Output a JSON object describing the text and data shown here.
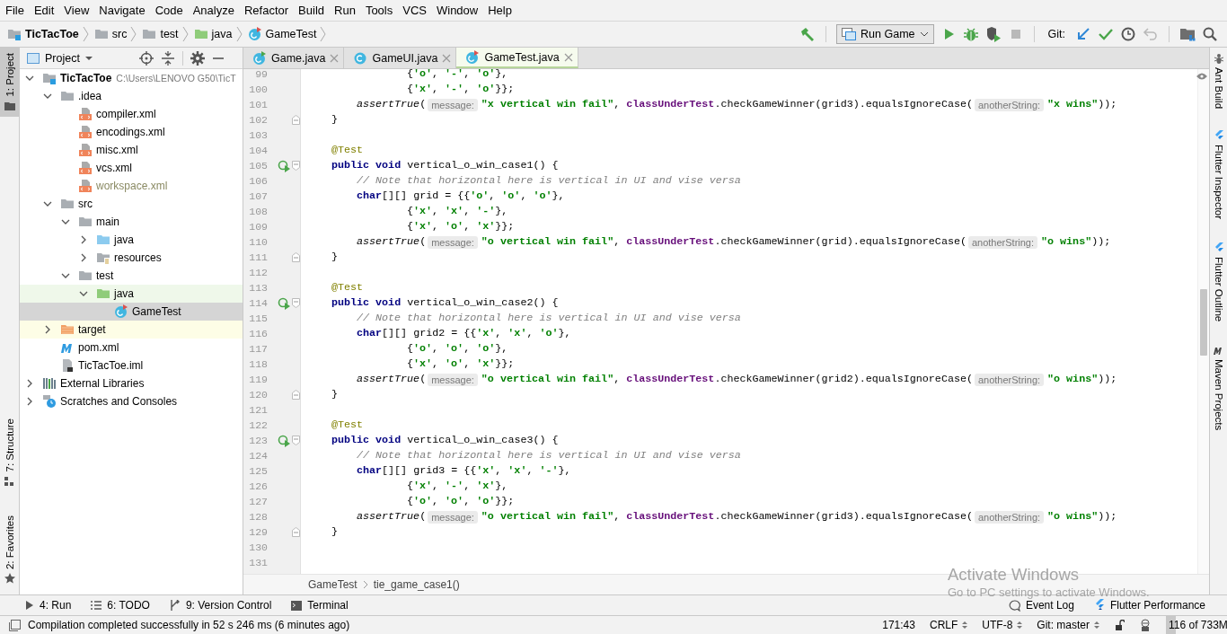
{
  "menu": [
    "File",
    "Edit",
    "View",
    "Navigate",
    "Code",
    "Analyze",
    "Refactor",
    "Build",
    "Run",
    "Tools",
    "VCS",
    "Window",
    "Help"
  ],
  "breadcrumb": [
    {
      "label": "TicTacToe",
      "kind": "module"
    },
    {
      "label": "src",
      "kind": "folder"
    },
    {
      "label": "test",
      "kind": "folder"
    },
    {
      "label": "java",
      "kind": "test-folder"
    },
    {
      "label": "GameTest",
      "kind": "test-class"
    }
  ],
  "toolbar": {
    "build_buttons": [
      {
        "kind": "build",
        "disabled": false
      }
    ],
    "run_config": "Run Game",
    "run_buttons": [
      {
        "kind": "run",
        "disabled": false
      },
      {
        "kind": "debug",
        "disabled": false
      },
      {
        "kind": "coverage",
        "disabled": false
      },
      {
        "kind": "stop",
        "disabled": true
      }
    ],
    "git_label": "Git:",
    "git_buttons": [
      {
        "kind": "update",
        "disabled": false
      },
      {
        "kind": "commit",
        "disabled": false
      },
      {
        "kind": "history",
        "disabled": false
      },
      {
        "kind": "revert",
        "disabled": true
      }
    ],
    "end_buttons": [
      {
        "kind": "structure",
        "disabled": false
      },
      {
        "kind": "search",
        "disabled": false
      }
    ]
  },
  "left_stripe": [
    {
      "label": "1: Project",
      "selected": true,
      "kind": "project"
    },
    {
      "label": "7: Structure",
      "selected": false,
      "kind": "structure"
    },
    {
      "label": "2: Favorites",
      "selected": false,
      "kind": "favorites"
    }
  ],
  "project": {
    "title": "Project",
    "tree": [
      {
        "label": "TicTacToe",
        "kind": "module",
        "path": "C:\\Users\\LENOVO G50\\TicT",
        "expanded": true,
        "selected": false,
        "children": [
          {
            "label": ".idea",
            "kind": "folder",
            "expanded": true,
            "selected": false,
            "children": [
              {
                "label": "compiler.xml",
                "kind": "xml",
                "selected": false,
                "ignored": false
              },
              {
                "label": "encodings.xml",
                "kind": "xml",
                "selected": false,
                "ignored": false
              },
              {
                "label": "misc.xml",
                "kind": "xml",
                "selected": false,
                "ignored": false
              },
              {
                "label": "vcs.xml",
                "kind": "xml",
                "selected": false,
                "ignored": false
              },
              {
                "label": "workspace.xml",
                "kind": "xml",
                "selected": false,
                "ignored": true
              }
            ]
          },
          {
            "label": "src",
            "kind": "folder",
            "expanded": true,
            "selected": false,
            "children": [
              {
                "label": "main",
                "kind": "folder",
                "expanded": true,
                "selected": false,
                "children": [
                  {
                    "label": "java",
                    "kind": "source-folder",
                    "expanded": false,
                    "selected": false
                  },
                  {
                    "label": "resources",
                    "kind": "resources-folder",
                    "expanded": false,
                    "selected": false
                  }
                ]
              },
              {
                "label": "test",
                "kind": "folder",
                "expanded": true,
                "selected": false,
                "children": [
                  {
                    "label": "java",
                    "kind": "test-folder",
                    "expanded": true,
                    "selected": false,
                    "children": [
                      {
                        "label": "GameTest",
                        "kind": "test-class",
                        "selected": true,
                        "ignored": false
                      }
                    ]
                  }
                ]
              }
            ]
          },
          {
            "label": "target",
            "kind": "excluded-folder",
            "expanded": false,
            "selected": false
          },
          {
            "label": "pom.xml",
            "kind": "maven",
            "selected": false,
            "ignored": false
          },
          {
            "label": "TicTacToe.iml",
            "kind": "iml",
            "selected": false,
            "ignored": false
          }
        ]
      },
      {
        "label": "External Libraries",
        "kind": "libraries",
        "expanded": false,
        "selected": false
      },
      {
        "label": "Scratches and Consoles",
        "kind": "scratches",
        "expanded": false,
        "selected": false
      }
    ]
  },
  "tabs": [
    {
      "label": "Game.java",
      "kind": "runnable-class",
      "selected": false
    },
    {
      "label": "GameUI.java",
      "kind": "class",
      "selected": false
    },
    {
      "label": "GameTest.java",
      "kind": "test-class",
      "selected": true
    }
  ],
  "editor": {
    "lines": [
      {
        "n": "99",
        "kind": "continuation",
        "segments": [
          {
            "kind": "code",
            "text": "{**'o'**, **'-'**, **'o'**},",
            "marks": [
              {
                "kind": "string"
              },
              {
                "kind": "string"
              },
              {
                "kind": "string"
              }
            ]
          }
        ]
      },
      {
        "n": "100",
        "kind": "continuation",
        "segments": [
          {
            "kind": "code",
            "text": "{**'x'**, **'-'**, **'o'**}};",
            "marks": [
              {
                "kind": "string"
              },
              {
                "kind": "string"
              },
              {
                "kind": "string"
              }
            ]
          }
        ]
      },
      {
        "n": "101",
        "kind": "body",
        "segments": [
          {
            "kind": "code",
            "text": "*assertTrue*(",
            "marks": [
              {
                "kind": "call"
              }
            ]
          },
          {
            "kind": "hint",
            "text": "message:"
          },
          {
            "kind": "code",
            "text": "**\"x vertical win fail\"**, **classUnderTest**.checkGameWinner(grid3).equalsIgnoreCase(",
            "marks": [
              {
                "kind": "string"
              },
              {
                "kind": "field"
              }
            ]
          },
          {
            "kind": "hint",
            "text": "anotherString:"
          },
          {
            "kind": "code",
            "text": "**\"x wins\"**));",
            "marks": [
              {
                "kind": "string"
              }
            ]
          }
        ]
      },
      {
        "n": "102",
        "kind": "member",
        "gutter": {
          "kind": "fold"
        },
        "segments": [
          {
            "kind": "code",
            "text": "}"
          }
        ]
      },
      {
        "n": "103"
      },
      {
        "n": "104",
        "kind": "member",
        "segments": [
          {
            "kind": "annotation",
            "text": "@Test"
          }
        ]
      },
      {
        "n": "105",
        "kind": "member",
        "gutter": {
          "kind": "run-fold"
        },
        "segments": [
          {
            "kind": "code",
            "text": "**public void** vertical_o_win_case1() {",
            "marks": [
              {
                "kind": "keyword"
              }
            ]
          }
        ]
      },
      {
        "n": "106",
        "kind": "body",
        "segments": [
          {
            "kind": "comment",
            "text": "// Note that horizontal here is vertical in UI and vise versa"
          }
        ]
      },
      {
        "n": "107",
        "kind": "body",
        "segments": [
          {
            "kind": "code",
            "text": "**char**[][] grid = {{**'o'**, **'o'**, **'o'**},",
            "marks": [
              {
                "kind": "keyword"
              },
              {
                "kind": "string"
              },
              {
                "kind": "string"
              },
              {
                "kind": "string"
              }
            ]
          }
        ]
      },
      {
        "n": "108",
        "kind": "continuation",
        "segments": [
          {
            "kind": "code",
            "text": "{**'x'**, **'x'**, **'-'**},",
            "marks": [
              {
                "kind": "string"
              },
              {
                "kind": "string"
              },
              {
                "kind": "string"
              }
            ]
          }
        ]
      },
      {
        "n": "109",
        "kind": "continuation",
        "segments": [
          {
            "kind": "code",
            "text": "{**'x'**, **'o'**, **'x'**}};",
            "marks": [
              {
                "kind": "string"
              },
              {
                "kind": "string"
              },
              {
                "kind": "string"
              }
            ]
          }
        ]
      },
      {
        "n": "110",
        "kind": "body",
        "segments": [
          {
            "kind": "code",
            "text": "*assertTrue*(",
            "marks": [
              {
                "kind": "call"
              }
            ]
          },
          {
            "kind": "hint",
            "text": "message:"
          },
          {
            "kind": "code",
            "text": "**\"o vertical win fail\"**, **classUnderTest**.checkGameWinner(grid).equalsIgnoreCase(",
            "marks": [
              {
                "kind": "string"
              },
              {
                "kind": "field"
              }
            ]
          },
          {
            "kind": "hint",
            "text": "anotherString:"
          },
          {
            "kind": "code",
            "text": "**\"o wins\"**));",
            "marks": [
              {
                "kind": "string"
              }
            ]
          }
        ]
      },
      {
        "n": "111",
        "kind": "member",
        "gutter": {
          "kind": "fold"
        },
        "segments": [
          {
            "kind": "code",
            "text": "}"
          }
        ]
      },
      {
        "n": "112"
      },
      {
        "n": "113",
        "kind": "member",
        "segments": [
          {
            "kind": "annotation",
            "text": "@Test"
          }
        ]
      },
      {
        "n": "114",
        "kind": "member",
        "gutter": {
          "kind": "run-fold"
        },
        "segments": [
          {
            "kind": "code",
            "text": "**public void** vertical_o_win_case2() {",
            "marks": [
              {
                "kind": "keyword"
              }
            ]
          }
        ]
      },
      {
        "n": "115",
        "kind": "body",
        "segments": [
          {
            "kind": "comment",
            "text": "// Note that horizontal here is vertical in UI and vise versa"
          }
        ]
      },
      {
        "n": "116",
        "kind": "body",
        "segments": [
          {
            "kind": "code",
            "text": "**char**[][] grid2 = {{**'x'**, **'x'**, **'o'**},",
            "marks": [
              {
                "kind": "keyword"
              },
              {
                "kind": "string"
              },
              {
                "kind": "string"
              },
              {
                "kind": "string"
              }
            ]
          }
        ]
      },
      {
        "n": "117",
        "kind": "continuation",
        "segments": [
          {
            "kind": "code",
            "text": "{**'o'**, **'o'**, **'o'**},",
            "marks": [
              {
                "kind": "string"
              },
              {
                "kind": "string"
              },
              {
                "kind": "string"
              }
            ]
          }
        ]
      },
      {
        "n": "118",
        "kind": "continuation",
        "segments": [
          {
            "kind": "code",
            "text": "{**'x'**, **'o'**, **'x'**}};",
            "marks": [
              {
                "kind": "string"
              },
              {
                "kind": "string"
              },
              {
                "kind": "string"
              }
            ]
          }
        ]
      },
      {
        "n": "119",
        "kind": "body",
        "segments": [
          {
            "kind": "code",
            "text": "*assertTrue*(",
            "marks": [
              {
                "kind": "call"
              }
            ]
          },
          {
            "kind": "hint",
            "text": "message:"
          },
          {
            "kind": "code",
            "text": "**\"o vertical win fail\"**, **classUnderTest**.checkGameWinner(grid2).equalsIgnoreCase(",
            "marks": [
              {
                "kind": "string"
              },
              {
                "kind": "field"
              }
            ]
          },
          {
            "kind": "hint",
            "text": "anotherString:"
          },
          {
            "kind": "code",
            "text": "**\"o wins\"**));",
            "marks": [
              {
                "kind": "string"
              }
            ]
          }
        ]
      },
      {
        "n": "120",
        "kind": "member",
        "gutter": {
          "kind": "fold"
        },
        "segments": [
          {
            "kind": "code",
            "text": "}"
          }
        ]
      },
      {
        "n": "121"
      },
      {
        "n": "122",
        "kind": "member",
        "segments": [
          {
            "kind": "annotation",
            "text": "@Test"
          }
        ]
      },
      {
        "n": "123",
        "kind": "member",
        "gutter": {
          "kind": "run-fold"
        },
        "segments": [
          {
            "kind": "code",
            "text": "**public void** vertical_o_win_case3() {",
            "marks": [
              {
                "kind": "keyword"
              }
            ]
          }
        ]
      },
      {
        "n": "124",
        "kind": "body",
        "segments": [
          {
            "kind": "comment",
            "text": "// Note that horizontal here is vertical in UI and vise versa"
          }
        ]
      },
      {
        "n": "125",
        "kind": "body",
        "segments": [
          {
            "kind": "code",
            "text": "**char**[][] grid3 = {{**'x'**, **'x'**, **'-'**},",
            "marks": [
              {
                "kind": "keyword"
              },
              {
                "kind": "string"
              },
              {
                "kind": "string"
              },
              {
                "kind": "string"
              }
            ]
          }
        ]
      },
      {
        "n": "126",
        "kind": "continuation",
        "segments": [
          {
            "kind": "code",
            "text": "{**'x'**, **'-'**, **'x'**},",
            "marks": [
              {
                "kind": "string"
              },
              {
                "kind": "string"
              },
              {
                "kind": "string"
              }
            ]
          }
        ]
      },
      {
        "n": "127",
        "kind": "continuation",
        "segments": [
          {
            "kind": "code",
            "text": "{**'o'**, **'o'**, **'o'**}};",
            "marks": [
              {
                "kind": "string"
              },
              {
                "kind": "string"
              },
              {
                "kind": "string"
              }
            ]
          }
        ]
      },
      {
        "n": "128",
        "kind": "body",
        "segments": [
          {
            "kind": "code",
            "text": "*assertTrue*(",
            "marks": [
              {
                "kind": "call"
              }
            ]
          },
          {
            "kind": "hint",
            "text": "message:"
          },
          {
            "kind": "code",
            "text": "**\"o vertical win fail\"**, **classUnderTest**.checkGameWinner(grid3).equalsIgnoreCase(",
            "marks": [
              {
                "kind": "string"
              },
              {
                "kind": "field"
              }
            ]
          },
          {
            "kind": "hint",
            "text": "anotherString:"
          },
          {
            "kind": "code",
            "text": "**\"o wins\"**));",
            "marks": [
              {
                "kind": "string"
              }
            ]
          }
        ]
      },
      {
        "n": "129",
        "kind": "member",
        "gutter": {
          "kind": "fold"
        },
        "segments": [
          {
            "kind": "code",
            "text": "}"
          }
        ]
      },
      {
        "n": "130"
      },
      {
        "n": "131"
      }
    ],
    "breadcrumb": [
      "GameTest",
      "tie_game_case1()"
    ]
  },
  "right_stripe": [
    {
      "label": "Ant Build",
      "kind": "ant"
    },
    {
      "label": "Flutter Inspector",
      "kind": "flutter"
    },
    {
      "label": "Flutter Outline",
      "kind": "flutter"
    },
    {
      "label": "Maven Projects",
      "kind": "maven"
    }
  ],
  "tool_windows": {
    "left": [
      {
        "label": "4: Run",
        "kind": "run"
      },
      {
        "label": "6: TODO",
        "kind": "todo"
      },
      {
        "label": "9: Version Control",
        "kind": "vcs"
      },
      {
        "label": "Terminal",
        "kind": "terminal"
      }
    ],
    "right": [
      {
        "label": "Event Log",
        "kind": "event"
      },
      {
        "label": "Flutter Performance",
        "kind": "flutter"
      }
    ]
  },
  "status_bar": {
    "message": "Compilation completed successfully in 52 s 246 ms (6 minutes ago)",
    "position": "171:43",
    "line_separator": "CRLF",
    "encoding": "UTF-8",
    "branch": "Git: master",
    "memory": {
      "label": "116 of 733M",
      "level": 0.16
    }
  },
  "os_overlay": {
    "title": "Activate Windows",
    "subtitle": "Go to PC settings to activate Windows."
  }
}
